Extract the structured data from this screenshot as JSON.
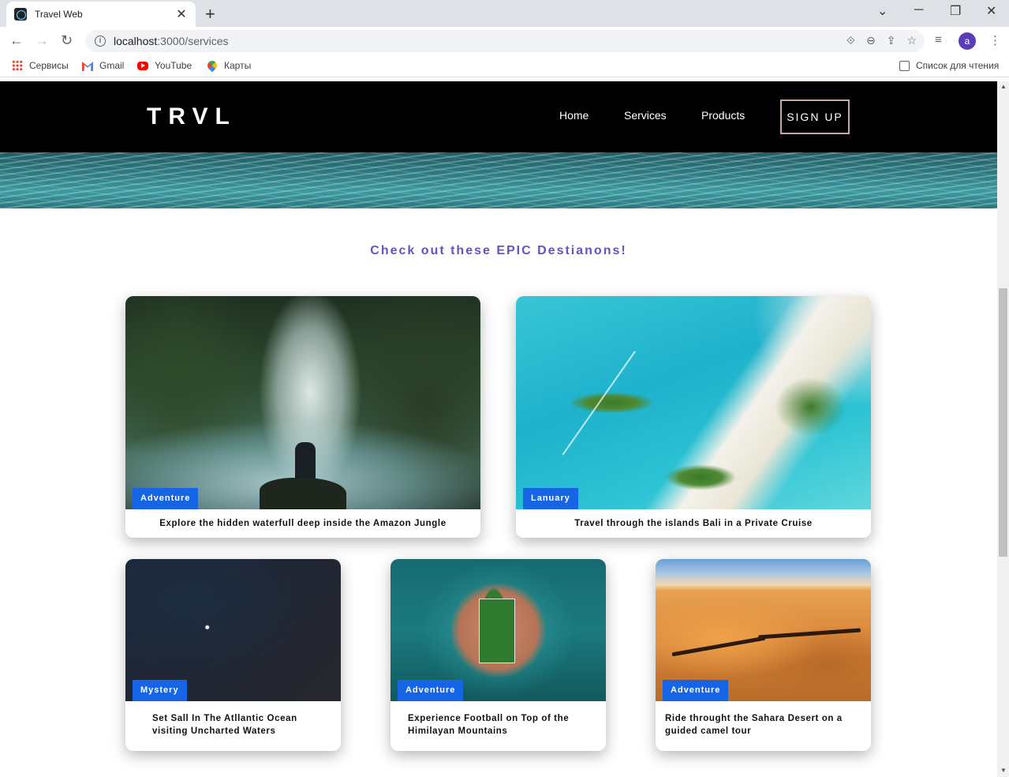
{
  "browser": {
    "tab_title": "Travel Web",
    "url_host": "localhost",
    "url_path": ":3000/services",
    "avatar_letter": "a",
    "bookmarks": [
      "Сервисы",
      "Gmail",
      "YouTube",
      "Карты"
    ],
    "reading_list": "Список для чтения"
  },
  "site": {
    "logo": "TRVL",
    "nav": [
      "Home",
      "Services",
      "Products"
    ],
    "signup": "SIGN UP",
    "heading": "Check out these EPIC Destianons!"
  },
  "cards": [
    {
      "tag": "Adventure",
      "text": "Explore the hidden waterfull deep inside the Amazon Jungle",
      "image": "waterfall-photo"
    },
    {
      "tag": "Lanuary",
      "text": "Travel through the islands Bali in a Private Cruise",
      "image": "bali-islands-photo"
    },
    {
      "tag": "Mystery",
      "text": "Set Sall In The Atllantic Ocean visiting Uncharted Waters",
      "image": "ocean-boat-photo"
    },
    {
      "tag": "Adventure",
      "text": "Experience Football on Top of the Himilayan Mountains",
      "image": "island-football-field-photo"
    },
    {
      "tag": "Adventure",
      "text": "Ride throught the Sahara Desert on a guided camel tour",
      "image": "desert-camels-photo"
    }
  ],
  "colors": {
    "heading": "#6b4fc4",
    "tag_bg": "#1565e6",
    "nav_bg": "#000000",
    "signup_border": "#c9a9a6"
  }
}
